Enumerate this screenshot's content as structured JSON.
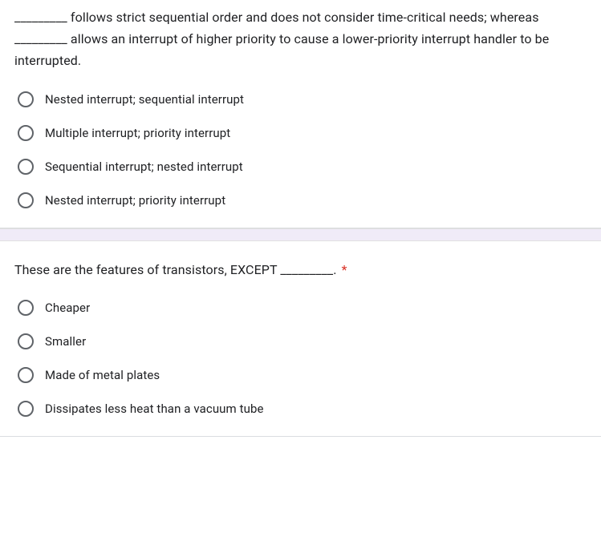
{
  "questions": [
    {
      "text": "_________ follows strict sequential order and does not consider time-critical needs; whereas _________ allows an interrupt of higher priority to cause a lower-priority interrupt handler to be interrupted.",
      "required": false,
      "options": [
        "Nested interrupt; sequential interrupt",
        "Multiple interrupt; priority interrupt",
        "Sequential interrupt; nested interrupt",
        "Nested interrupt; priority interrupt"
      ]
    },
    {
      "text": "These are the features of transistors, EXCEPT _________.",
      "required": true,
      "options": [
        "Cheaper",
        "Smaller",
        "Made of metal plates",
        "Dissipates less heat than a vacuum tube"
      ]
    }
  ],
  "required_marker": "*"
}
